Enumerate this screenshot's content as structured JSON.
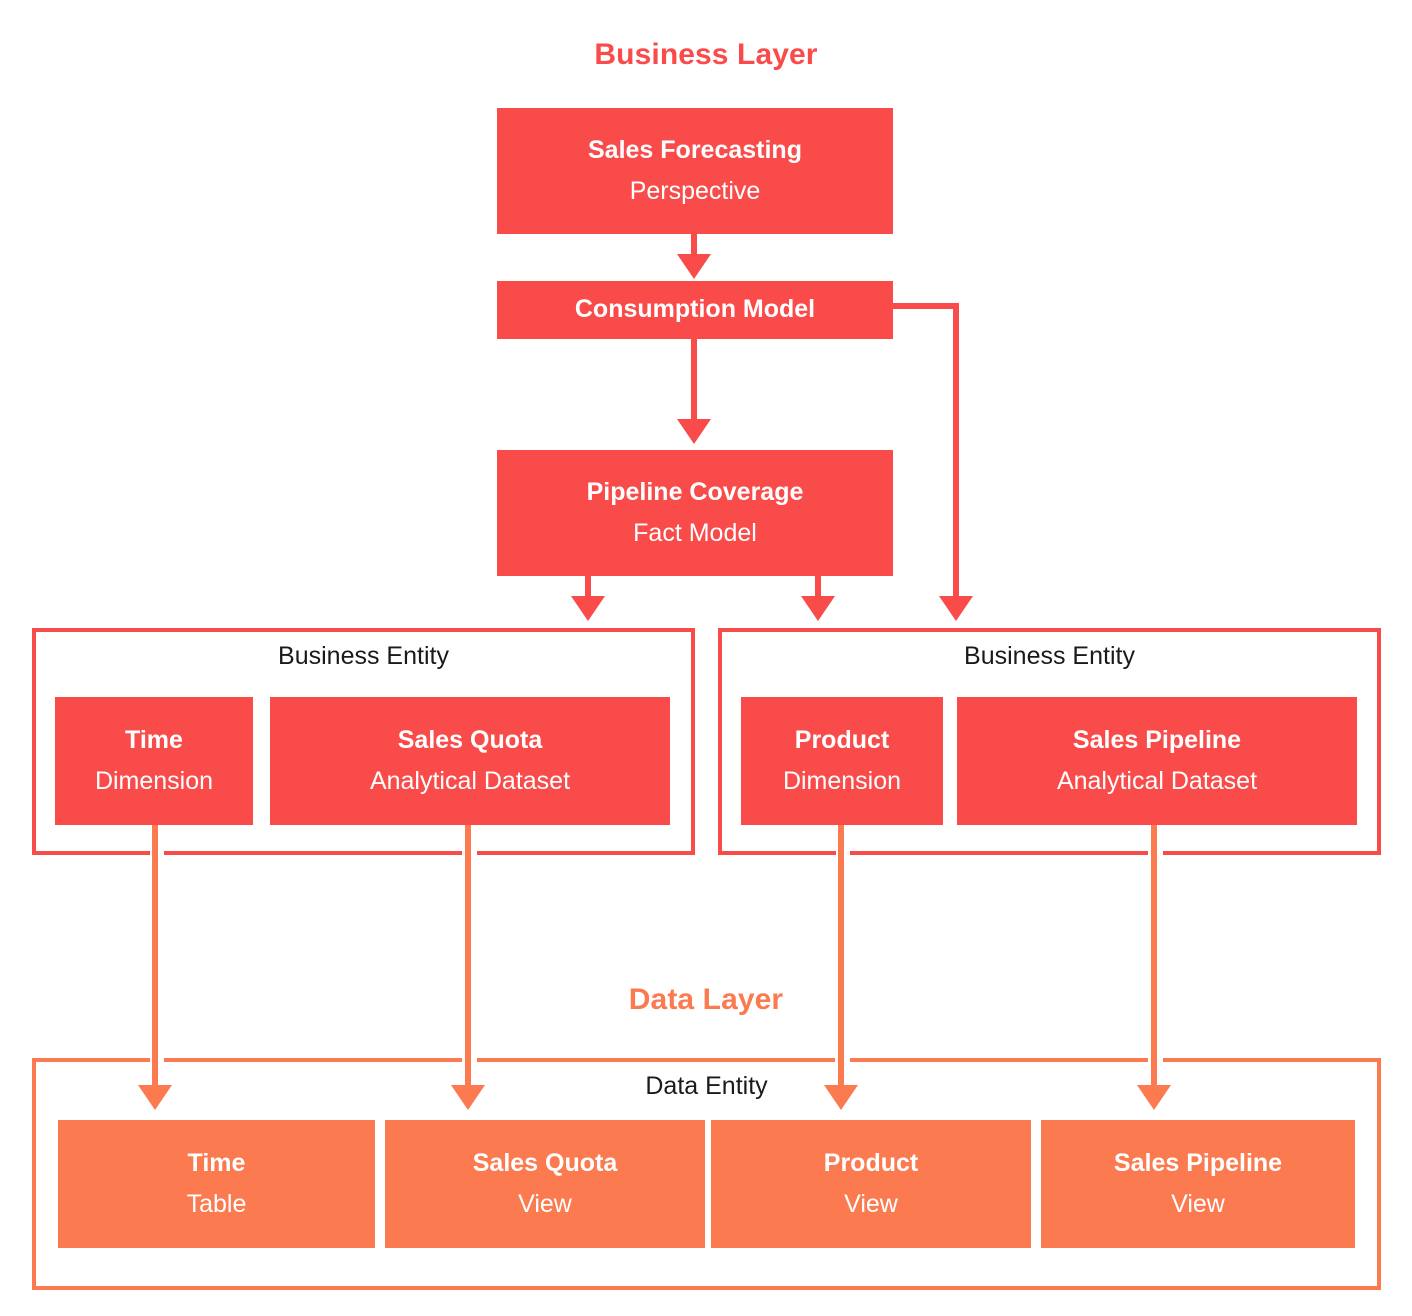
{
  "diagram": {
    "title_business": "Business Layer",
    "title_data": "Data Layer"
  },
  "colors": {
    "business_red": "#FA4B4B",
    "data_orange": "#FB7A50",
    "label_black": "#1A1A1A",
    "node_text": "#FFFFFF",
    "background": "#FFFFFF"
  },
  "business_layer": {
    "label": "Business Layer",
    "nodes": [
      {
        "name": "Sales Forecasting",
        "type": "Perspective"
      },
      {
        "name": "Consumption Model",
        "type": ""
      },
      {
        "name": "Pipeline Coverage",
        "type": "Fact Model"
      }
    ],
    "entities": [
      {
        "container_label": "Business Entity",
        "items": [
          {
            "name": "Time",
            "type": "Dimension"
          },
          {
            "name": "Sales Quota",
            "type": "Analytical Dataset"
          }
        ]
      },
      {
        "container_label": "Business Entity",
        "items": [
          {
            "name": "Product",
            "type": "Dimension"
          },
          {
            "name": "Sales Pipeline",
            "type": "Analytical Dataset"
          }
        ]
      }
    ]
  },
  "data_layer": {
    "label": "Data Layer",
    "container_label": "Data Entity",
    "items": [
      {
        "name": "Time",
        "type": "Table"
      },
      {
        "name": "Sales Quota",
        "type": "View"
      },
      {
        "name": "Product",
        "type": "View"
      },
      {
        "name": "Sales Pipeline",
        "type": "View"
      }
    ]
  }
}
